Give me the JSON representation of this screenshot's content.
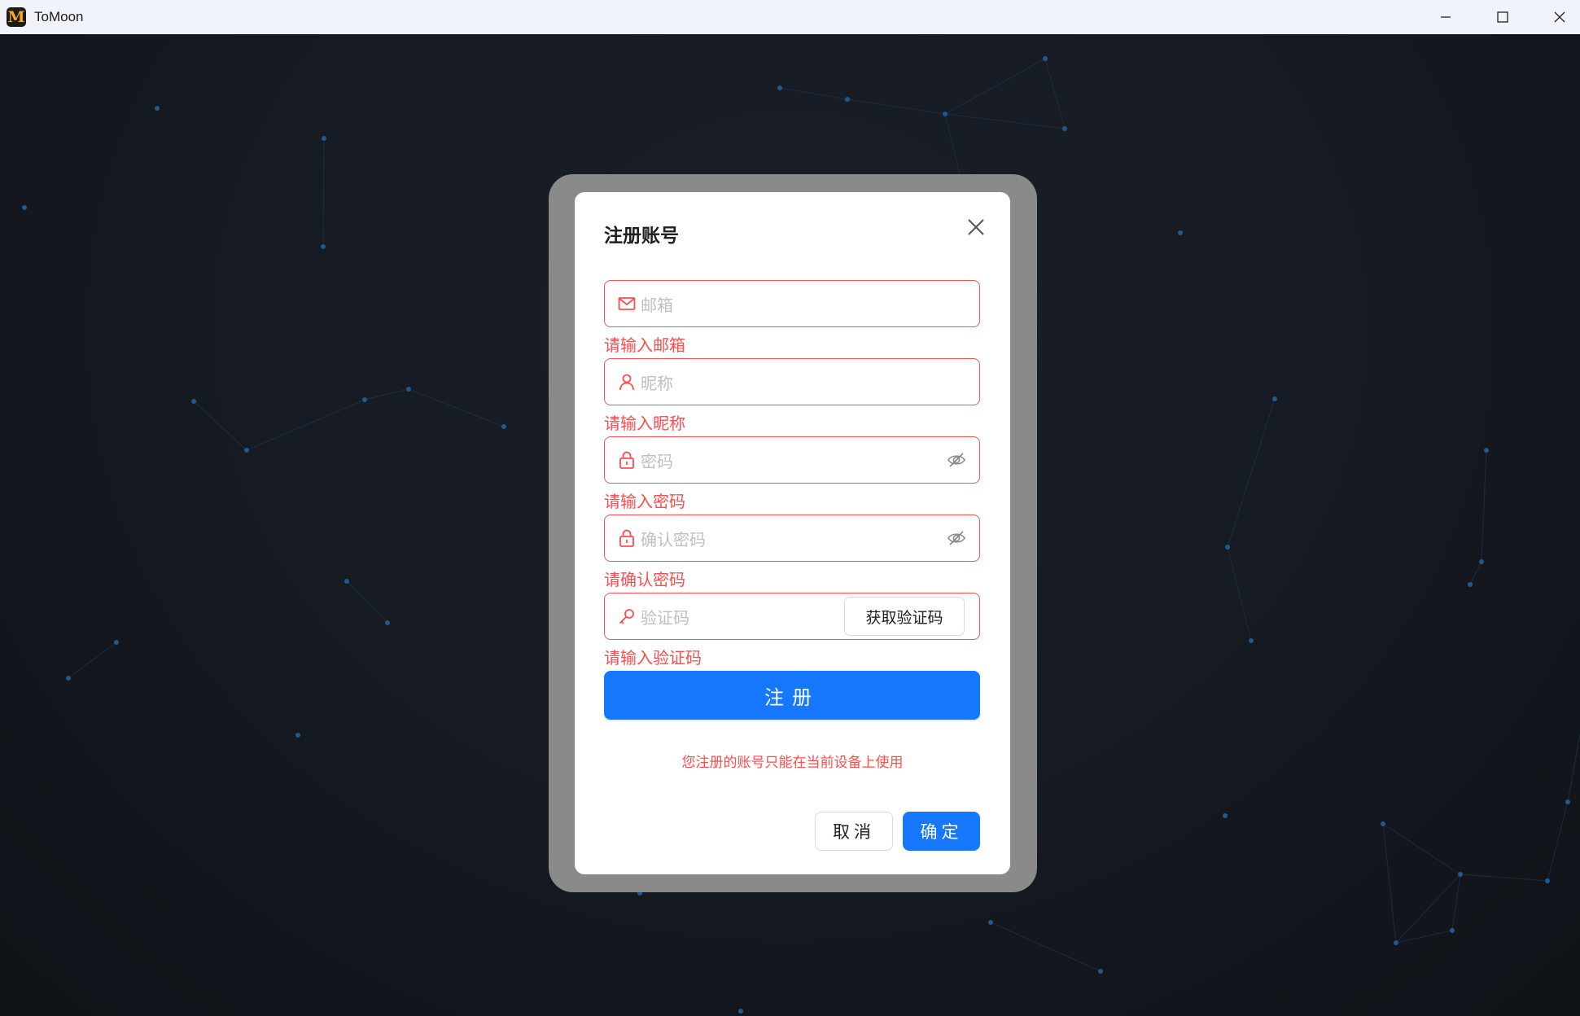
{
  "window": {
    "icon_letter": "M",
    "title": "ToMoon"
  },
  "dialog": {
    "title": "注册账号",
    "fields": [
      {
        "placeholder": "邮箱",
        "error": "请输入邮箱",
        "icon": "mail-icon"
      },
      {
        "placeholder": "昵称",
        "error": "请输入昵称",
        "icon": "user-icon"
      },
      {
        "placeholder": "密码",
        "error": "请输入密码",
        "icon": "lock-icon",
        "toggle": "eye-invisible-icon"
      },
      {
        "placeholder": "确认密码",
        "error": "请确认密码",
        "icon": "lock-icon",
        "toggle": "eye-invisible-icon"
      },
      {
        "placeholder": "验证码",
        "error": "请输入验证码",
        "icon": "key-icon",
        "action_label": "获取验证码"
      }
    ],
    "register_label": "注册",
    "notice": "您注册的账号只能在当前设备上使用",
    "cancel_label": "取消",
    "ok_label": "确定"
  },
  "colors": {
    "primary": "#1677ff",
    "error": "#ff4d4f",
    "background": "#12151c"
  }
}
